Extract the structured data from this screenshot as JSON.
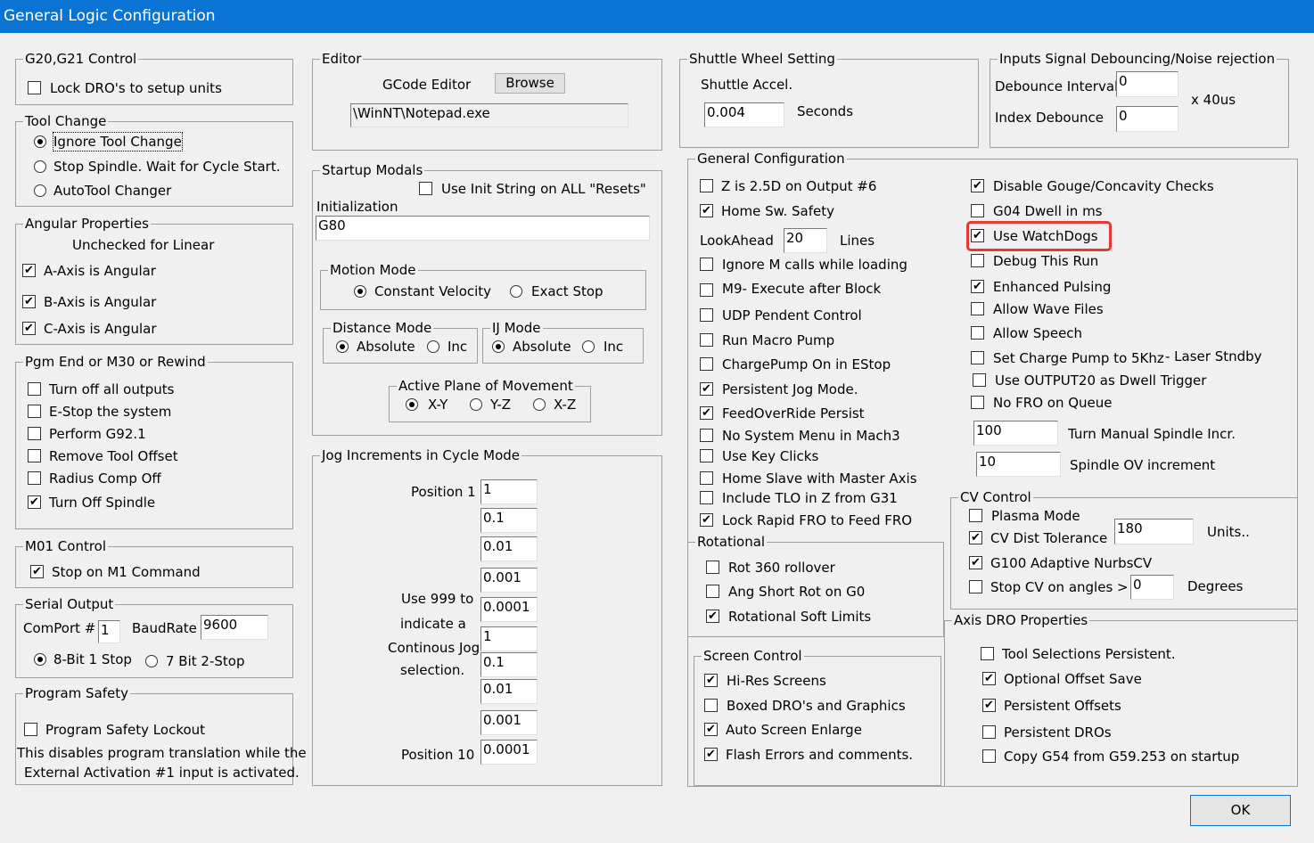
{
  "window": {
    "title": "General Logic Configuration"
  },
  "g20": {
    "title": "G20,G21 Control",
    "lock": "Lock DRO's to setup units"
  },
  "tool_change": {
    "title": "Tool Change",
    "ignore": "Ignore Tool Change",
    "stop": "Stop Spindle. Wait for Cycle Start.",
    "auto": "AutoTool Changer"
  },
  "angular": {
    "title": "Angular Properties",
    "subtitle": "Unchecked for Linear",
    "a": "A-Axis is Angular",
    "b": "B-Axis is Angular",
    "c": "C-Axis is Angular"
  },
  "pgm_end": {
    "title": "Pgm End or M30 or Rewind",
    "items": [
      "Turn off all outputs",
      "E-Stop the system",
      "Perform G92.1",
      "Remove Tool Offset",
      "Radius Comp Off",
      "Turn Off Spindle"
    ]
  },
  "m01": {
    "title": "M01 Control",
    "stop": "Stop on M1 Command"
  },
  "serial": {
    "title": "Serial Output",
    "comport_label": "ComPort #",
    "comport": "1",
    "baud_label": "BaudRate",
    "baud": "9600",
    "stop1": "8-Bit 1 Stop",
    "stop2": "7 Bit 2-Stop"
  },
  "safety": {
    "title": "Program Safety",
    "lockout": "Program Safety Lockout",
    "note1": "This disables program translation while the",
    "note2": "External Activation #1 input is activated."
  },
  "editor": {
    "title": "Editor",
    "label": "GCode Editor",
    "browse": "Browse",
    "path": "\\WinNT\\Notepad.exe"
  },
  "startup": {
    "title": "Startup Modals",
    "use_init": "Use Init String on ALL  \"Resets\"",
    "init_label": "Initialization",
    "init_value": "G80"
  },
  "motion": {
    "title": "Motion Mode",
    "cv": "Constant Velocity",
    "exact": "Exact Stop"
  },
  "distance": {
    "title": "Distance Mode",
    "abs": "Absolute",
    "inc": "Inc"
  },
  "ij": {
    "title": "IJ Mode",
    "abs": "Absolute",
    "inc": "Inc"
  },
  "plane": {
    "title": "Active Plane of Movement",
    "xy": "X-Y",
    "yz": "Y-Z",
    "xz": "X-Z"
  },
  "jog": {
    "title": "Jog Increments in Cycle Mode",
    "pos1": "Position 1",
    "pos10": "Position 10",
    "note1": "Use 999 to",
    "note2": "indicate a",
    "note3": "Continous Jog",
    "note4": "selection.",
    "values": [
      "1",
      "0.1",
      "0.01",
      "0.001",
      "0.0001",
      "1",
      "0.1",
      "0.01",
      "0.001",
      "0.0001"
    ]
  },
  "shuttle": {
    "title": "Shuttle Wheel Setting",
    "label": "Shuttle Accel.",
    "value": "0.004",
    "unit": "Seconds"
  },
  "debounce": {
    "title": "Inputs Signal Debouncing/Noise rejection",
    "interval_label": "Debounce Interval:",
    "interval": "0",
    "index_label": "Index Debounce",
    "index": "0",
    "unit": "x 40us"
  },
  "general": {
    "title": "General Configuration",
    "left": [
      "Z is 2.5D on Output #6",
      "Home Sw. Safety",
      "Ignore M calls while loading",
      "M9- Execute after Block",
      "UDP Pendent Control",
      "Run Macro Pump",
      "ChargePump On in EStop",
      "Persistent Jog Mode.",
      "FeedOverRide Persist",
      "No System Menu in Mach3",
      "Use Key Clicks",
      "Home Slave with Master Axis",
      "Include TLO in Z from G31",
      "Lock Rapid FRO to Feed FRO"
    ],
    "lookahead_label": "LookAhead",
    "lookahead": "20",
    "lines": "Lines",
    "right": [
      "Disable Gouge/Concavity Checks",
      "G04 Dwell in ms",
      "Use WatchDogs",
      "Debug This Run",
      "Enhanced Pulsing",
      "Allow Wave Files",
      "Allow Speech",
      "Set Charge Pump to 5Khz",
      "Use OUTPUT20 as Dwell Trigger",
      "No FRO on Queue"
    ],
    "laser": "- Laser Stndby",
    "spindle_incr": "100",
    "spindle_incr_label": "Turn Manual Spindle Incr.",
    "spindle_ov": "10",
    "spindle_ov_label": "Spindle OV increment"
  },
  "rotational": {
    "title": "Rotational",
    "items": [
      "Rot 360 rollover",
      "Ang Short Rot on G0",
      "Rotational Soft Limits"
    ]
  },
  "screen": {
    "title": "Screen Control",
    "items": [
      "Hi-Res Screens",
      "Boxed DRO's and Graphics",
      "Auto Screen Enlarge",
      "Flash Errors and comments."
    ]
  },
  "cv": {
    "title": "CV Control",
    "plasma": "Plasma Mode",
    "dist": "CV Dist Tolerance",
    "dist_value": "180",
    "units": "Units..",
    "nurbs": "G100 Adaptive NurbsCV",
    "stop_angles": "Stop CV on angles >",
    "angle_value": "0",
    "degrees": "Degrees"
  },
  "axis_dro": {
    "title": "Axis DRO Properties",
    "items": [
      "Tool Selections Persistent.",
      "Optional Offset Save",
      "Persistent Offsets",
      "Persistent DROs",
      "Copy G54 from G59.253 on startup"
    ]
  },
  "ok": "OK",
  "check": "✔"
}
